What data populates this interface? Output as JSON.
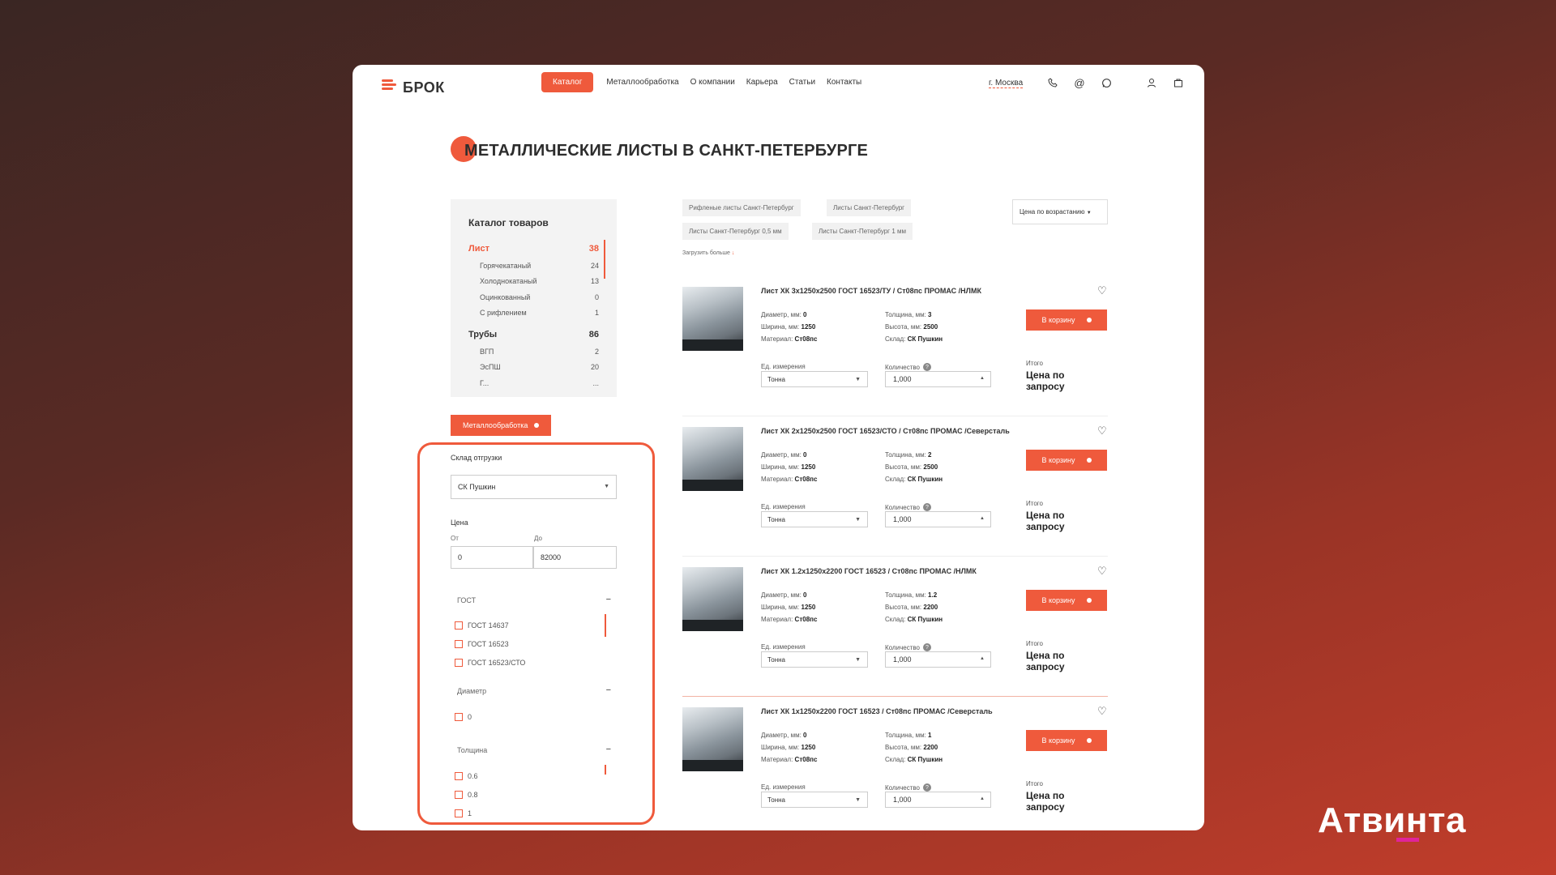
{
  "logo": {
    "text": "БРОК"
  },
  "nav": {
    "catalog": "Каталог",
    "items": [
      "Металлообработка",
      "О компании",
      "Карьера",
      "Статьи",
      "Контакты"
    ]
  },
  "header": {
    "city": "г. Москва",
    "icons": [
      "phone-icon",
      "at-icon",
      "whatsapp-icon",
      "user-icon",
      "bag-icon"
    ]
  },
  "title": "МЕТАЛЛИЧЕСКИЕ ЛИСТЫ В САНКТ-ПЕТЕРБУРГЕ",
  "catalog": {
    "heading": "Каталог товаров",
    "items": [
      {
        "label": "Лист",
        "count": "38"
      },
      {
        "label": "Горячекатаный",
        "count": "24"
      },
      {
        "label": "Холоднокатаный",
        "count": "13"
      },
      {
        "label": "Оцинкованный",
        "count": "0"
      },
      {
        "label": "С рифлением",
        "count": "1"
      },
      {
        "label": "Трубы",
        "count": "86"
      },
      {
        "label": "ВГП",
        "count": "2"
      },
      {
        "label": "ЭсПШ",
        "count": "20"
      },
      {
        "label": "Г...",
        "count": "..."
      }
    ]
  },
  "metal_button": "Металлообработка",
  "filter": {
    "warehouse_label": "Склад отгрузки",
    "warehouse_value": "СК Пушкин",
    "price_label": "Цена",
    "from_label": "От",
    "to_label": "До",
    "from_value": "0",
    "to_value": "82000",
    "gost_label": "ГОСТ",
    "gost_options": [
      "ГОСТ 14637",
      "ГОСТ 16523",
      "ГОСТ 16523/СТО"
    ],
    "diameter_label": "Диаметр",
    "diameter_options": [
      "0"
    ],
    "thickness_label": "Толщина",
    "thickness_options": [
      "0.6",
      "0.8",
      "1"
    ]
  },
  "tags": [
    "Рифленые листы Санкт-Петербург",
    "Листы Санкт-Петербург",
    "Листы Санкт-Петербург 0,5 мм",
    "Листы Санкт-Петербург 1 мм"
  ],
  "load_more": "Загрузить больше",
  "sort": "Цена по возрастанию",
  "labels": {
    "diameter": "Диаметр, мм:",
    "width": "Ширина, мм:",
    "material": "Материал:",
    "thickness": "Толщина, мм:",
    "height": "Высота, мм:",
    "warehouse": "Склад:",
    "unit": "Ед. измерения",
    "quantity": "Количество",
    "total": "Итого",
    "cart": "В корзину"
  },
  "products": [
    {
      "name": "Лист ХК 3х1250х2500 ГОСТ 16523/ТУ / Ст08пс ПРОМАС /НЛМК",
      "diameter": "0",
      "width": "1250",
      "material": "Ст08пс",
      "thickness": "3",
      "height": "2500",
      "warehouse": "СК Пушкин",
      "unit": "Тонна",
      "qty": "1,000",
      "total": "Цена по запросу"
    },
    {
      "name": "Лист ХК 2х1250х2500 ГОСТ 16523/СТО / Ст08пс ПРОМАС /Северсталь",
      "diameter": "0",
      "width": "1250",
      "material": "Ст08пс",
      "thickness": "2",
      "height": "2500",
      "warehouse": "СК Пушкин",
      "unit": "Тонна",
      "qty": "1,000",
      "total": "Цена по запросу"
    },
    {
      "name": "Лист ХК 1.2х1250х2200 ГОСТ 16523 / Ст08пс ПРОМАС /НЛМК",
      "diameter": "0",
      "width": "1250",
      "material": "Ст08пс",
      "thickness": "1.2",
      "height": "2200",
      "warehouse": "СК Пушкин",
      "unit": "Тонна",
      "qty": "1,000",
      "total": "Цена по запросу"
    },
    {
      "name": "Лист ХК 1х1250х2200 ГОСТ 16523 / Ст08пс ПРОМАС /Северсталь",
      "diameter": "0",
      "width": "1250",
      "material": "Ст08пс",
      "thickness": "1",
      "height": "2200",
      "warehouse": "СК Пушкин",
      "unit": "Тонна",
      "qty": "1,000",
      "total": "Цена по запросу"
    }
  ],
  "brand": "Атвинта",
  "colors": {
    "accent": "#ef5a3c",
    "brand_bar": "#e0249a"
  }
}
